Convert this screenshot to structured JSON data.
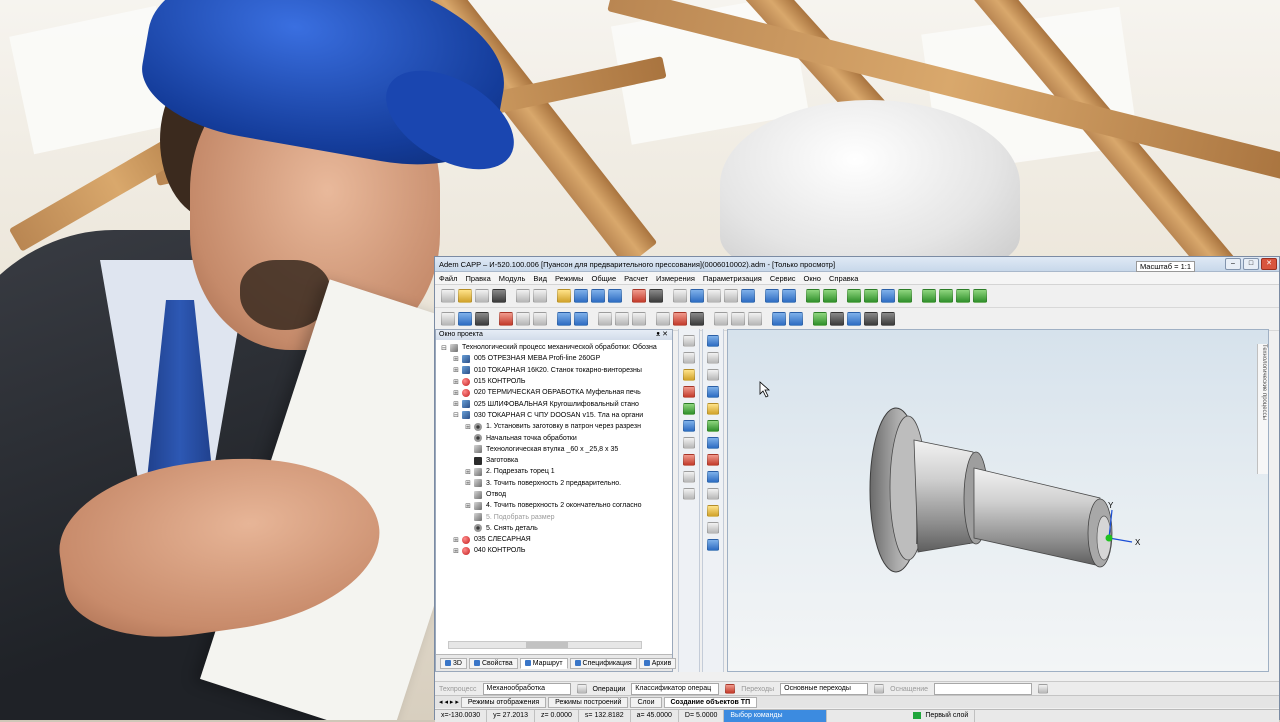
{
  "window": {
    "title": "Adem CAPP – И-520.100.006 [Пуансон для предварительного прессования](0006010002).adm - [Только просмотр]",
    "scale_label": "Масштаб = 1:1"
  },
  "menu": [
    "Файл",
    "Правка",
    "Модуль",
    "Вид",
    "Режимы",
    "Общие",
    "Расчет",
    "Измерения",
    "Параметризация",
    "Сервис",
    "Окно",
    "Справка"
  ],
  "project_panel": {
    "title": "Окно проекта",
    "tree": [
      {
        "text": "Технологический процесс механической обработки: Обозна",
        "icon": "sub",
        "exp": "⊟",
        "indent": 0
      },
      {
        "text": "005  ОТРЕЗНАЯ MEBA  Profi-line 260GP",
        "icon": "tool",
        "exp": "⊞",
        "indent": 1
      },
      {
        "text": "010  ТОКАРНАЯ 16К20. Станок токарно-винторезны",
        "icon": "tool",
        "exp": "⊞",
        "indent": 1
      },
      {
        "text": "015  КОНТРОЛЬ",
        "icon": "red",
        "exp": "⊞",
        "indent": 1
      },
      {
        "text": "020  ТЕРМИЧЕСКАЯ ОБРАБОТКА Муфельная печь",
        "icon": "red",
        "exp": "⊞",
        "indent": 1
      },
      {
        "text": "025  ШЛИФОВАЛЬНАЯ Кругошлифовальный стано",
        "icon": "tool",
        "exp": "⊞",
        "indent": 1
      },
      {
        "text": "030  ТОКАРНАЯ С ЧПУ DOOSAN v15. Тла на органи",
        "icon": "tool",
        "exp": "⊟",
        "indent": 1
      },
      {
        "text": "1. Установить заготовку в патрон через  разрезн",
        "icon": "gear",
        "exp": "⊞",
        "indent": 2
      },
      {
        "text": "Начальная точка обработки",
        "icon": "gear",
        "exp": "",
        "indent": 2
      },
      {
        "text": "Технологическая втулка _60 х _25,8 х 35",
        "icon": "sub",
        "exp": "",
        "indent": 2
      },
      {
        "text": "Заготовка",
        "icon": "blank",
        "exp": "",
        "indent": 2
      },
      {
        "text": "2. Подрезать  торец 1",
        "icon": "sub",
        "exp": "⊞",
        "indent": 2
      },
      {
        "text": "3. Точить поверхность 2 предварительно.",
        "icon": "sub",
        "exp": "⊞",
        "indent": 2
      },
      {
        "text": "Отвод",
        "icon": "sub",
        "exp": "",
        "indent": 2
      },
      {
        "text": "4. Точить поверхность 2 окончательно согласно",
        "icon": "sub",
        "exp": "⊞",
        "indent": 2
      },
      {
        "text": "5. Подобрать размер",
        "icon": "sub",
        "exp": "",
        "indent": 2,
        "grey": true
      },
      {
        "text": "5. Снять деталь",
        "icon": "gear",
        "exp": "",
        "indent": 2
      },
      {
        "text": "035  СЛЕСАРНАЯ",
        "icon": "red",
        "exp": "⊞",
        "indent": 1
      },
      {
        "text": "040  КОНТРОЛЬ",
        "icon": "red",
        "exp": "⊞",
        "indent": 1
      }
    ],
    "tabs": [
      {
        "label": "3D"
      },
      {
        "label": "Свойства"
      },
      {
        "label": "Маршрут",
        "active": true
      },
      {
        "label": "Спецификация"
      },
      {
        "label": "Архив"
      }
    ]
  },
  "view3d": {
    "axis_x": "X",
    "axis_y": "Y",
    "side_label": "Технологические процессы"
  },
  "params": {
    "operation_group_label": "Техпроцесс",
    "operation_group_value": "Механообработка",
    "operation_label": "Операции",
    "operation_value": "Классификатор операц",
    "transitions_label": "Переходы",
    "transitions_value": "Основные переходы",
    "equipment_label": "Оснащение"
  },
  "mode_tabs": [
    {
      "label": "Режимы отображения"
    },
    {
      "label": "Режимы построений"
    },
    {
      "label": "Слои"
    },
    {
      "label": "Создание объектов ТП",
      "active": true
    }
  ],
  "status": {
    "x": "x=-130.0030",
    "y": "y= 27.2013",
    "z": "z= 0.0000",
    "s": "s= 132.8182",
    "angle": "a= 45.0000",
    "d": "D= 5.0000",
    "command": "Выбор команды",
    "layer": "Первый слой"
  },
  "colors": {
    "accent": "#3c8be0",
    "layer_green": "#1fa53a"
  }
}
